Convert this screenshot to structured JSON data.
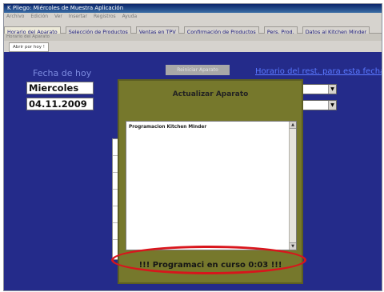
{
  "window": {
    "title": "K Pliego: Miércoles de Muestra Aplicación"
  },
  "menubar": {
    "items": [
      "Archivo",
      "Edición",
      "Ver",
      "Insertar",
      "Registros",
      "Ayuda"
    ]
  },
  "tabs": [
    {
      "label": "Horario del Aparato",
      "active": true
    },
    {
      "label": "Selección de Productos",
      "active": false
    },
    {
      "label": "Ventas en TPV",
      "active": false
    },
    {
      "label": "Confirmación de Productos",
      "active": false
    },
    {
      "label": "Pers. Prod.",
      "active": false
    },
    {
      "label": "Datos al Kitchen Minder",
      "active": false
    }
  ],
  "subbar": {
    "text": "Horario del Aparato"
  },
  "subtab": {
    "label": "Abrir por hoy !"
  },
  "main": {
    "date_title": "Fecha de hoy",
    "weekday": "Miercoles",
    "date": "04.11.2009",
    "gray_button": "Reiniciar Aparato",
    "horario_label": "Horario del rest. para esta fecha"
  },
  "dialog": {
    "title": "Actualizar Aparato",
    "list_items": [
      "Programacion Kitchen Minder"
    ],
    "status": "!!! Programaci    en curso  0:03 !!!"
  },
  "colors": {
    "content_bg": "#242b8a",
    "dialog_bg": "#76782c",
    "highlight": "#d8151c",
    "link_blue": "#5a78ff"
  }
}
